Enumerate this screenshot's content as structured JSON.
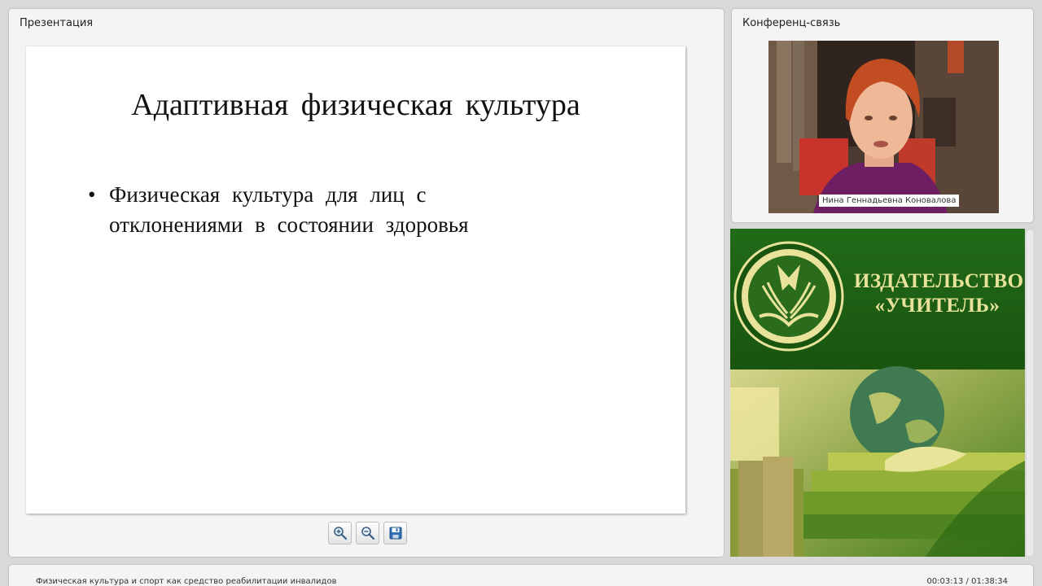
{
  "presentation": {
    "title": "Презентация",
    "slide": {
      "heading": "Адаптивная  физическая культура",
      "bullet": "Физическая культура для лиц с отклонениями в состоянии здоровья"
    },
    "toolbar": {
      "zoom_in": "zoom-in-icon",
      "zoom_out": "zoom-out-icon",
      "save": "save-icon"
    }
  },
  "conference": {
    "title": "Конференц-связь",
    "participant_name": "Нина Геннадьевна Коновалова"
  },
  "banner": {
    "publisher_line1": "ИЗДАТЕЛЬСТВО",
    "publisher_line2": "«УЧИТЕЛЬ»",
    "colors": {
      "green": "#1a5d10",
      "gold": "#e8e29a"
    }
  },
  "status": {
    "lecture_title": "Физическая культура и спорт как средство реабилитации инвалидов",
    "time": "00:03:13 / 01:38:34"
  }
}
